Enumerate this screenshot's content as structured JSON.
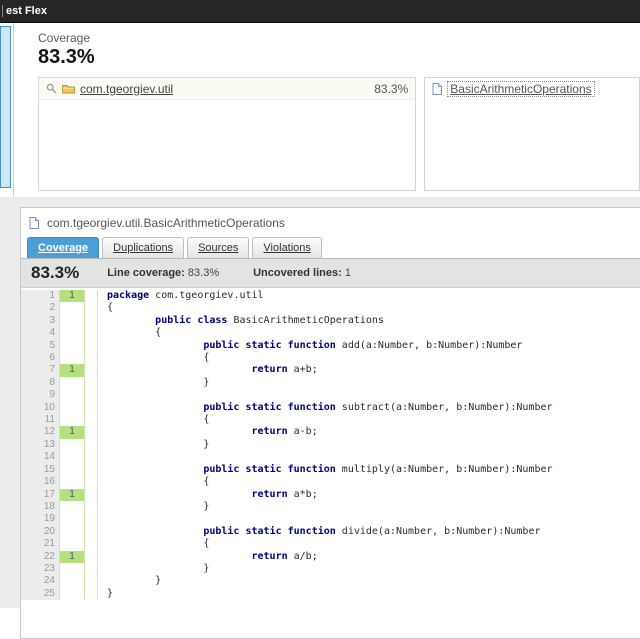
{
  "topbar": {
    "title": "est Flex"
  },
  "colors": {
    "accent_blue": "#4b9fd5",
    "covered_green": "#b4e07d",
    "keyword_blue": "#000080",
    "strip_blue": "#cfe6f5"
  },
  "icons": {
    "search": "magnifier",
    "folder": "yellow-folder",
    "file": "blue-outline-document"
  },
  "overview": {
    "metric_label": "Coverage",
    "metric_value": "83.3%",
    "package_panel": {
      "package_name": "com.tgeorgiev.util",
      "coverage": "83.3%"
    },
    "file_panel": {
      "file_name": "BasicArithmeticOperations"
    }
  },
  "detail": {
    "title": "com.tgeorgiev.util.BasicArithmeticOperations",
    "tabs": [
      {
        "label": "Coverage",
        "active": true
      },
      {
        "label": "Duplications",
        "active": false
      },
      {
        "label": "Sources",
        "active": false
      },
      {
        "label": "Violations",
        "active": false
      }
    ],
    "summary": {
      "value": "83.3%",
      "line_coverage_label": "Line coverage:",
      "line_coverage_value": "83.3%",
      "uncovered_label": "Uncovered lines:",
      "uncovered_value": "1"
    },
    "code": {
      "lines": [
        {
          "n": "1",
          "hits": "1",
          "covered": true,
          "code": [
            {
              "t": "kw",
              "s": "package"
            },
            {
              "t": "tx",
              "s": " com.tgeorgiev.util"
            }
          ]
        },
        {
          "n": "2",
          "hits": "",
          "covered": false,
          "code": [
            {
              "t": "tx",
              "s": "{"
            }
          ]
        },
        {
          "n": "3",
          "hits": "",
          "covered": false,
          "code": [
            {
              "t": "tx",
              "s": "        "
            },
            {
              "t": "kw",
              "s": "public class"
            },
            {
              "t": "tx",
              "s": " BasicArithmeticOperations"
            }
          ]
        },
        {
          "n": "4",
          "hits": "",
          "covered": false,
          "code": [
            {
              "t": "tx",
              "s": "        {"
            }
          ]
        },
        {
          "n": "5",
          "hits": "",
          "covered": false,
          "code": [
            {
              "t": "tx",
              "s": "                "
            },
            {
              "t": "kw",
              "s": "public static function"
            },
            {
              "t": "tx",
              "s": " add(a:Number, b:Number):Number"
            }
          ]
        },
        {
          "n": "6",
          "hits": "",
          "covered": false,
          "code": [
            {
              "t": "tx",
              "s": "                {"
            }
          ]
        },
        {
          "n": "7",
          "hits": "1",
          "covered": true,
          "code": [
            {
              "t": "tx",
              "s": "                        "
            },
            {
              "t": "kw",
              "s": "return"
            },
            {
              "t": "tx",
              "s": " a+b;"
            }
          ]
        },
        {
          "n": "8",
          "hits": "",
          "covered": false,
          "code": [
            {
              "t": "tx",
              "s": "                }"
            }
          ]
        },
        {
          "n": "9",
          "hits": "",
          "covered": false,
          "code": []
        },
        {
          "n": "10",
          "hits": "",
          "covered": false,
          "code": [
            {
              "t": "tx",
              "s": "                "
            },
            {
              "t": "kw",
              "s": "public static function"
            },
            {
              "t": "tx",
              "s": " subtract(a:Number, b:Number):Number"
            }
          ]
        },
        {
          "n": "11",
          "hits": "",
          "covered": false,
          "code": [
            {
              "t": "tx",
              "s": "                {"
            }
          ]
        },
        {
          "n": "12",
          "hits": "1",
          "covered": true,
          "code": [
            {
              "t": "tx",
              "s": "                        "
            },
            {
              "t": "kw",
              "s": "return"
            },
            {
              "t": "tx",
              "s": " a-b;"
            }
          ]
        },
        {
          "n": "13",
          "hits": "",
          "covered": false,
          "code": [
            {
              "t": "tx",
              "s": "                }"
            }
          ]
        },
        {
          "n": "14",
          "hits": "",
          "covered": false,
          "code": []
        },
        {
          "n": "15",
          "hits": "",
          "covered": false,
          "code": [
            {
              "t": "tx",
              "s": "                "
            },
            {
              "t": "kw",
              "s": "public static function"
            },
            {
              "t": "tx",
              "s": " multiply(a:Number, b:Number):Number"
            }
          ]
        },
        {
          "n": "16",
          "hits": "",
          "covered": false,
          "code": [
            {
              "t": "tx",
              "s": "                {"
            }
          ]
        },
        {
          "n": "17",
          "hits": "1",
          "covered": true,
          "code": [
            {
              "t": "tx",
              "s": "                        "
            },
            {
              "t": "kw",
              "s": "return"
            },
            {
              "t": "tx",
              "s": " a*b;"
            }
          ]
        },
        {
          "n": "18",
          "hits": "",
          "covered": false,
          "code": [
            {
              "t": "tx",
              "s": "                }"
            }
          ]
        },
        {
          "n": "19",
          "hits": "",
          "covered": false,
          "code": []
        },
        {
          "n": "20",
          "hits": "",
          "covered": false,
          "code": [
            {
              "t": "tx",
              "s": "                "
            },
            {
              "t": "kw",
              "s": "public static function"
            },
            {
              "t": "tx",
              "s": " divide(a:Number, b:Number):Number"
            }
          ]
        },
        {
          "n": "21",
          "hits": "",
          "covered": false,
          "code": [
            {
              "t": "tx",
              "s": "                {"
            }
          ]
        },
        {
          "n": "22",
          "hits": "1",
          "covered": true,
          "code": [
            {
              "t": "tx",
              "s": "                        "
            },
            {
              "t": "kw",
              "s": "return"
            },
            {
              "t": "tx",
              "s": " a/b;"
            }
          ]
        },
        {
          "n": "23",
          "hits": "",
          "covered": false,
          "code": [
            {
              "t": "tx",
              "s": "                }"
            }
          ]
        },
        {
          "n": "24",
          "hits": "",
          "covered": false,
          "code": [
            {
              "t": "tx",
              "s": "        }"
            }
          ]
        },
        {
          "n": "25",
          "hits": "",
          "covered": false,
          "code": [
            {
              "t": "tx",
              "s": "}"
            }
          ]
        }
      ]
    }
  }
}
